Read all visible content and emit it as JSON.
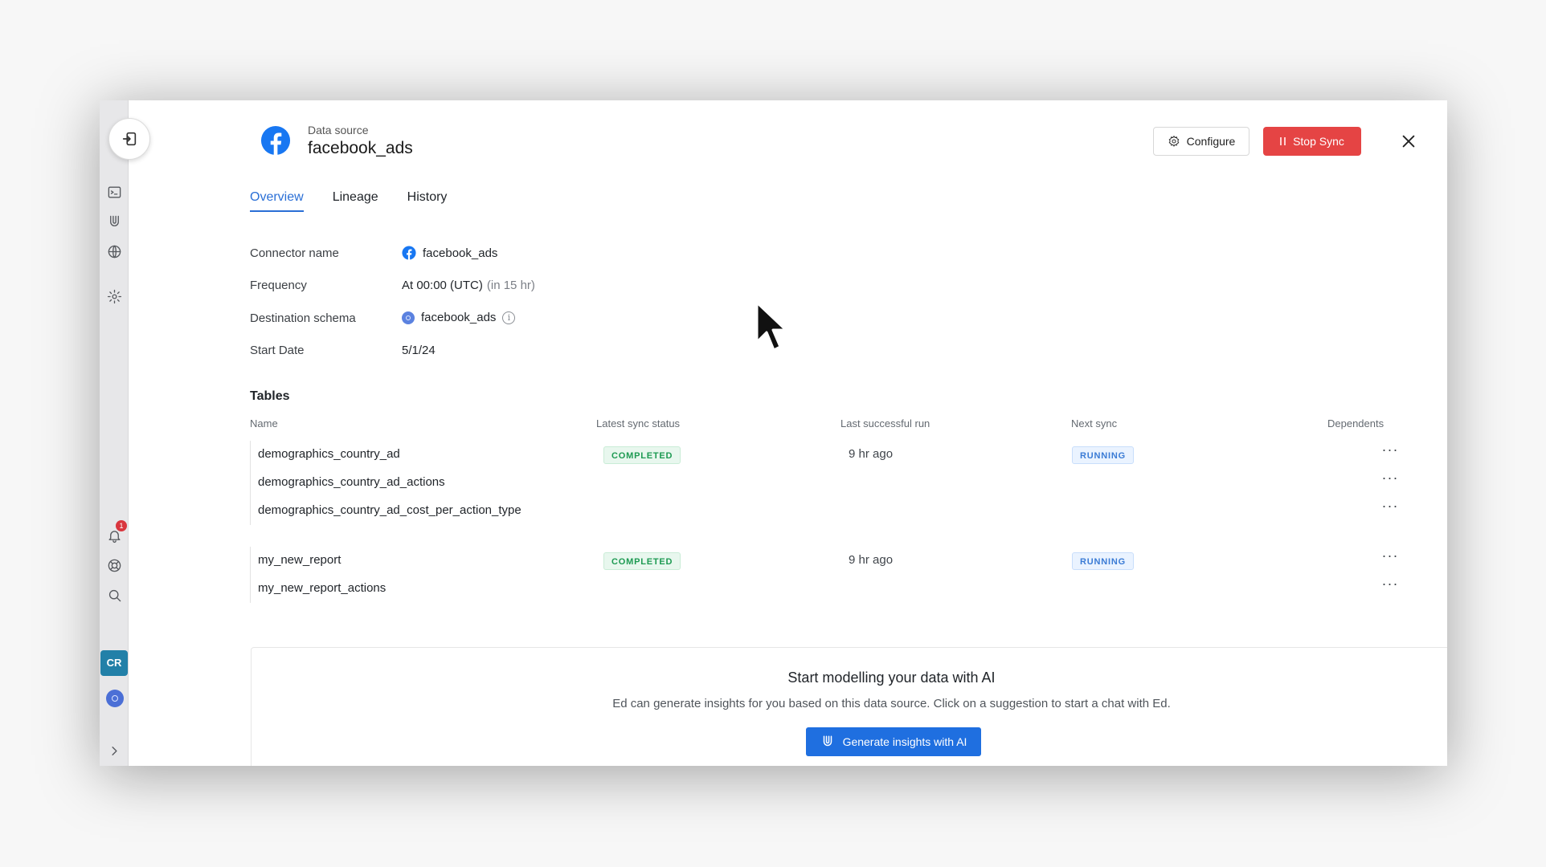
{
  "header": {
    "subtitle": "Data source",
    "title": "facebook_ads",
    "configure_label": "Configure",
    "stop_label": "Stop Sync"
  },
  "tabs": [
    {
      "label": "Overview",
      "active": true
    },
    {
      "label": "Lineage",
      "active": false
    },
    {
      "label": "History",
      "active": false
    }
  ],
  "overview": {
    "connector_label": "Connector name",
    "connector_value": "facebook_ads",
    "frequency_label": "Frequency",
    "frequency_value": "At 00:00 (UTC)",
    "frequency_hint": "(in 15 hr)",
    "schema_label": "Destination schema",
    "schema_value": "facebook_ads",
    "start_label": "Start Date",
    "start_value": "5/1/24"
  },
  "tables": {
    "title": "Tables",
    "columns": [
      "Name",
      "Latest sync status",
      "Last successful run",
      "Next sync",
      "Dependents"
    ],
    "groups": [
      {
        "rows": [
          {
            "name": "demographics_country_ad",
            "status": "COMPLETED",
            "last_run": "9 hr ago",
            "next_sync": "RUNNING"
          },
          {
            "name": "demographics_country_ad_actions"
          },
          {
            "name": "demographics_country_ad_cost_per_action_type"
          }
        ]
      },
      {
        "rows": [
          {
            "name": "my_new_report",
            "status": "COMPLETED",
            "last_run": "9 hr ago",
            "next_sync": "RUNNING"
          },
          {
            "name": "my_new_report_actions"
          }
        ]
      }
    ],
    "more_glyph": "···"
  },
  "ai": {
    "title": "Start modelling your data with AI",
    "description": "Ed can generate insights for you based on this data source. Click on a suggestion to start a chat with Ed.",
    "button_label": "Generate insights with AI"
  },
  "sidebar": {
    "notification_count": "1",
    "avatar_initials": "CR",
    "icons": [
      "terminal-icon",
      "ai-magnet-icon",
      "globe-icon",
      "settings-icon",
      "bell-icon",
      "help-icon",
      "search-icon"
    ]
  },
  "colors": {
    "accent": "#2a6fd6",
    "stop": "#e54444",
    "completed": "#1d9a52",
    "running": "#3a7bd5",
    "facebook": "#1877f2"
  }
}
